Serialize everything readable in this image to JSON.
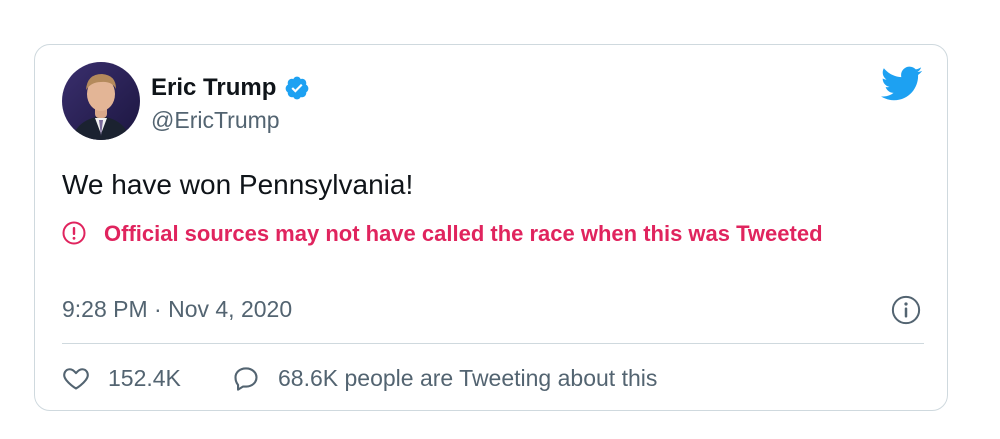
{
  "tweet": {
    "author_name": "Eric Trump",
    "author_handle": "@EricTrump",
    "verified": true,
    "text": "We have won Pennsylvania!",
    "warning": "Official sources may not have called the race when this was Tweeted",
    "timestamp": "9:28 PM · Nov 4, 2020",
    "likes": "152.4K",
    "conversation": "68.6K people are Tweeting about this"
  },
  "icons": {
    "brand": "twitter-bird-icon",
    "verified": "verified-badge-icon",
    "warning": "exclamation-circle-icon",
    "info": "info-icon",
    "like": "heart-icon",
    "reply": "speech-bubble-icon"
  },
  "colors": {
    "brand_blue": "#1da1f2",
    "warning_red": "#e0245e",
    "text_primary": "#0f1419",
    "text_secondary": "#536471",
    "border": "#cfd9de"
  }
}
